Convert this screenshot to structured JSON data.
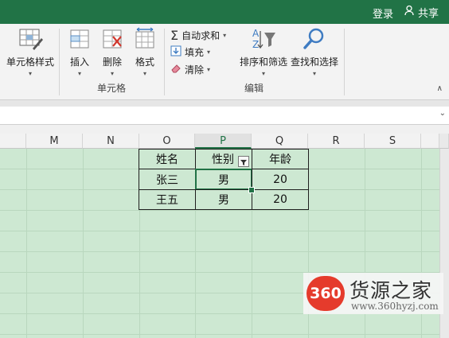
{
  "titlebar": {
    "login": "登录",
    "share": "共享"
  },
  "ribbon": {
    "cell_style": "单元格样式",
    "insert": "插入",
    "delete": "删除",
    "format": "格式",
    "group_cells": "单元格",
    "autosum": "自动求和",
    "fill": "填充",
    "clear": "清除",
    "sort_filter": "排序和筛选",
    "find_select": "查找和选择",
    "group_edit": "编辑"
  },
  "columns": [
    "M",
    "N",
    "O",
    "P",
    "Q",
    "R",
    "S"
  ],
  "selected_column": "P",
  "table": {
    "headers": [
      "姓名",
      "性别",
      "年龄"
    ],
    "rows": [
      [
        "张三",
        "男",
        "20"
      ],
      [
        "王五",
        "男",
        "20"
      ]
    ]
  },
  "watermark": {
    "logo": "360",
    "name": "货源之家",
    "url": "www.360hyzj.com"
  },
  "colors": {
    "excel_green": "#217346",
    "sheet_tint": "#cde8d2",
    "logo_red": "#e53b2c"
  }
}
